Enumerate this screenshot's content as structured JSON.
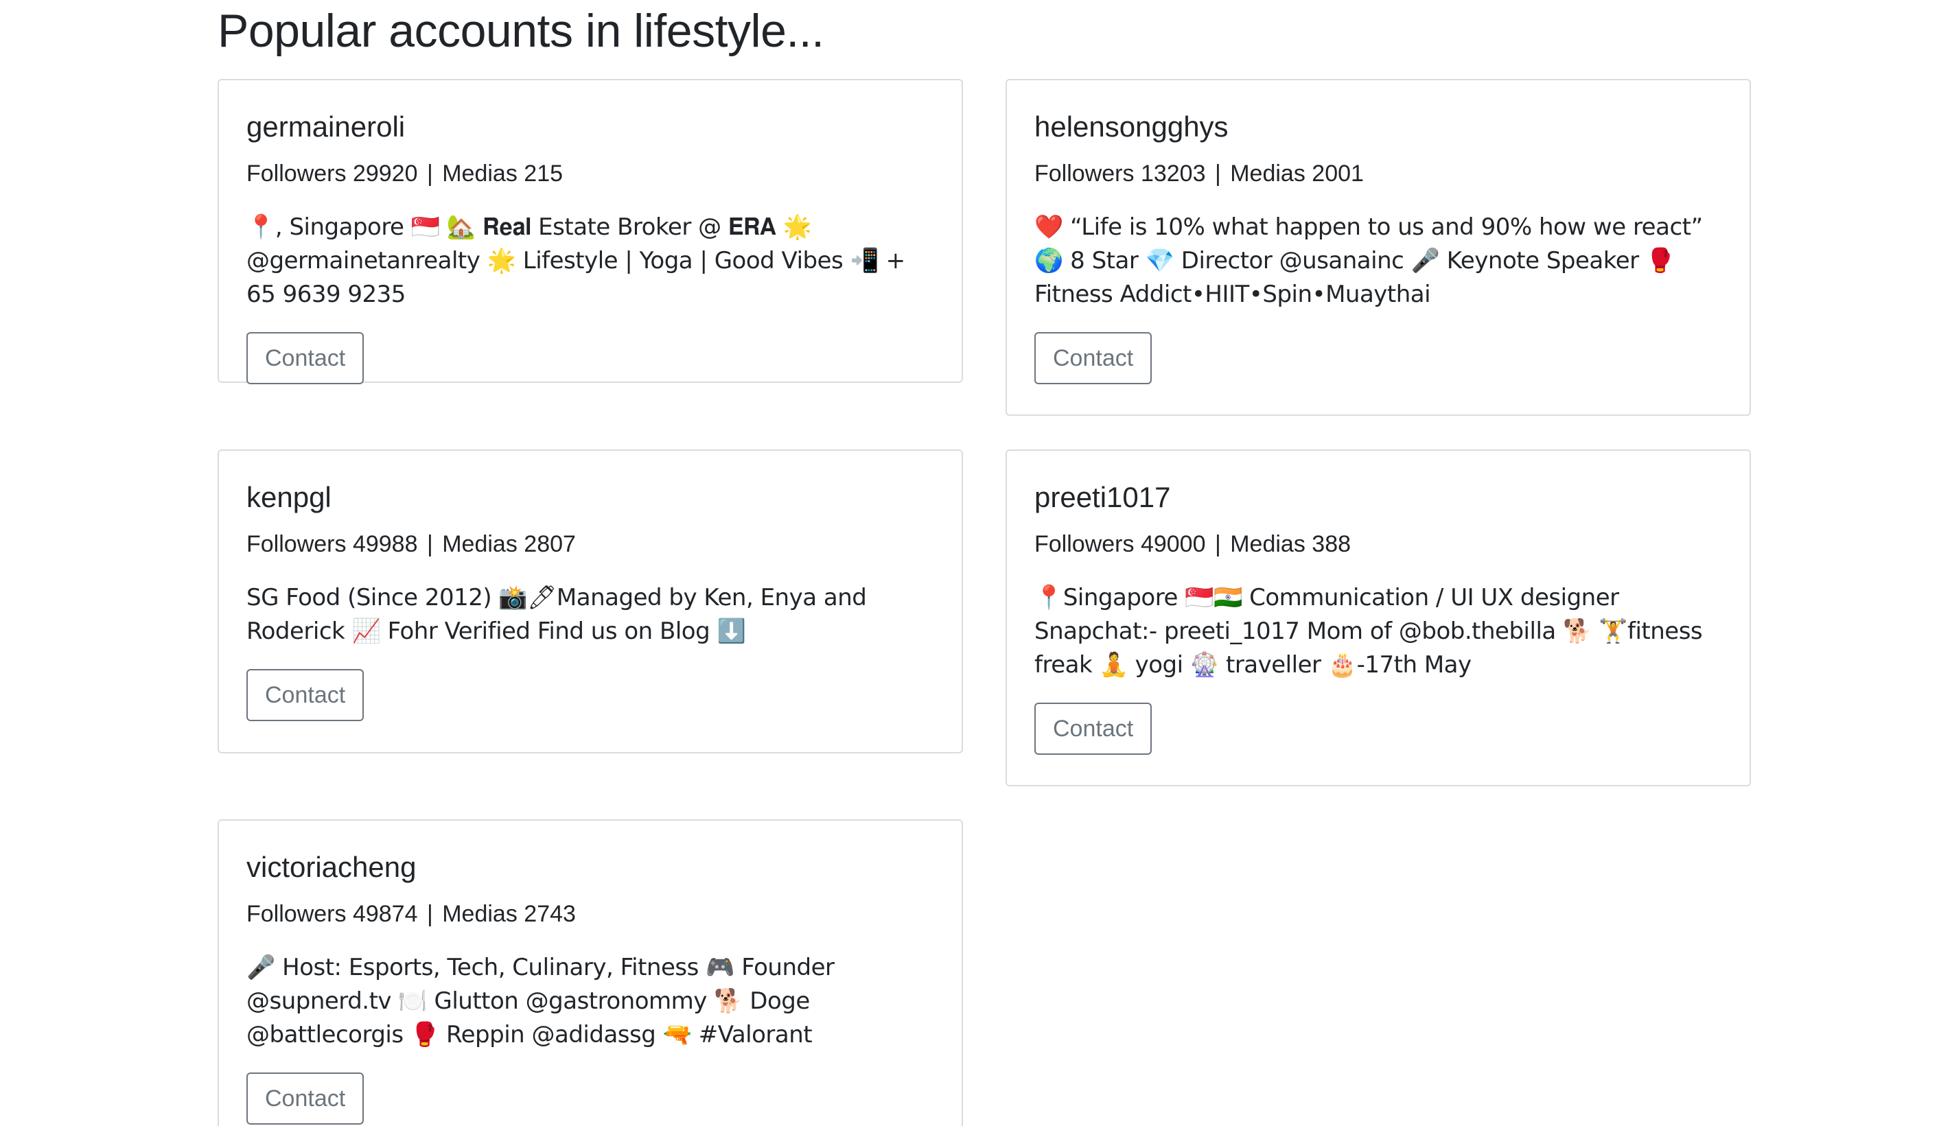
{
  "page": {
    "title": "Popular accounts in lifestyle..."
  },
  "cards": [
    {
      "username": "germaineroli",
      "followers_label": "Followers",
      "followers": "29920",
      "separator": "|",
      "medias_label": "Medias",
      "medias": "215",
      "bio": "📍, Singapore 🇸🇬 🏡 𝐑𝐞𝐚𝐥 Estate Broker @ 𝐄𝐑𝐀 🌟@germainetanrealty 🌟 Lifestyle | Yoga | Good Vibes 📲 + 65 9639 9235",
      "button_label": "Contact"
    },
    {
      "username": "helensongghys",
      "followers_label": "Followers",
      "followers": "13203",
      "separator": "|",
      "medias_label": "Medias",
      "medias": "2001",
      "bio": "❤️ “Life is 10% what happen to us and 90% how we react” 🌍 8 Star 💎 Director @usanainc 🎤 Keynote Speaker 🥊 Fitness Addict•HIIT•Spin•Muaythai",
      "button_label": "Contact"
    },
    {
      "username": "kenpgl",
      "followers_label": "Followers",
      "followers": "49988",
      "separator": "|",
      "medias_label": "Medias",
      "medias": "2807",
      "bio": "SG Food (Since 2012) 📸🖊Managed by Ken, Enya and Roderick 📈 Fohr Verified Find us on Blog ⬇️",
      "button_label": "Contact"
    },
    {
      "username": "preeti1017",
      "followers_label": "Followers",
      "followers": "49000",
      "separator": "|",
      "medias_label": "Medias",
      "medias": "388",
      "bio": "📍Singapore 🇸🇬🇮🇳 Communication / UI UX designer Snapchat:- preeti_1017 Mom of @bob.thebilla 🐕 🏋fitness freak 🧘 yogi 🎡 traveller 🎂-17th May",
      "button_label": "Contact"
    },
    {
      "username": "victoriacheng",
      "followers_label": "Followers",
      "followers": "49874",
      "separator": "|",
      "medias_label": "Medias",
      "medias": "2743",
      "bio": "🎤 Host: Esports, Tech, Culinary, Fitness 🎮 Founder @supnerd.tv 🍽️ Glutton @gastronommy 🐕 Doge @battlecorgis 🥊 Reppin @adidassg 🔫 #Valorant",
      "button_label": "Contact"
    }
  ]
}
